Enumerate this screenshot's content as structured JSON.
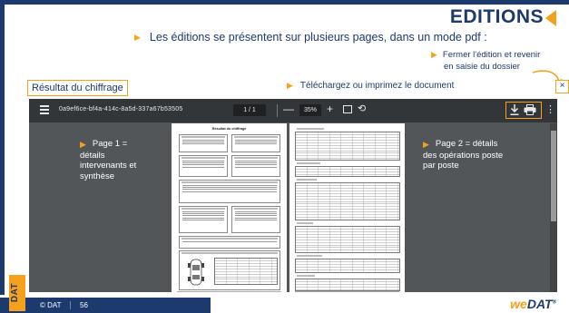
{
  "slide": {
    "title": "EDITIONS",
    "intro": "Les éditions se présentent sur plusieurs pages, dans un mode pdf :",
    "close_hint_line1": "Fermer l'édition et revenir",
    "close_hint_line2": "en saisie du dossier",
    "download_hint": "Téléchargez ou imprimez le document",
    "annotation_left": "Page 1 = détails intervenants et synthèse",
    "annotation_right": "Page 2 = détails des opérations poste par poste"
  },
  "viewer": {
    "title": "Résultat du chiffrage",
    "close_label": "×",
    "filename": "0a9ef6ce-bf4a-414c-8a5d-337a67b53505",
    "page_indicator": "1 / 1",
    "zoom": "35%",
    "minus": "—",
    "plus": "+",
    "more": "⋮",
    "rotate": "⟲"
  },
  "pages": {
    "page1_title": "Résultat du chiffrage"
  },
  "footer": {
    "copyright": "© DAT",
    "page_number": "56",
    "badge": "DAT",
    "brand_we": "we",
    "brand_name": "DAT",
    "brand_mark": "®"
  },
  "colors": {
    "navy": "#1d3a6e",
    "accent": "#f5a11c",
    "viewer_bg": "#525659",
    "toolbar_bg": "#323639"
  }
}
